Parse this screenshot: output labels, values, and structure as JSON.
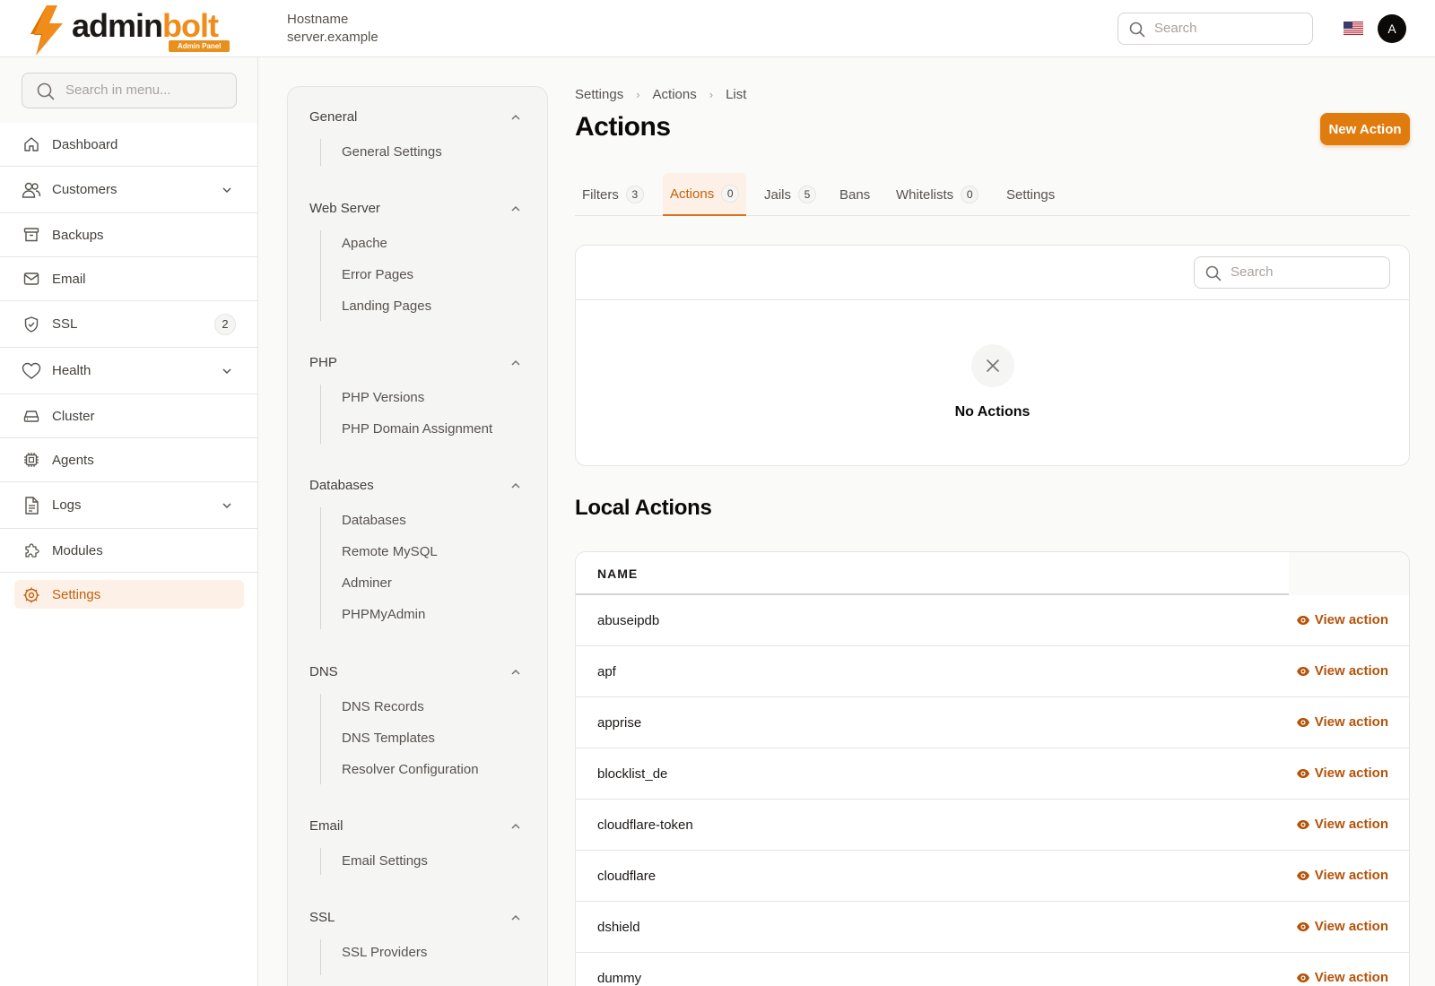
{
  "brand": {
    "name_part1": "admin",
    "name_part2": "bolt",
    "badge": "Admin Panel"
  },
  "header": {
    "hostname_label": "Hostname",
    "hostname_value": "server.example",
    "search_placeholder": "Search",
    "avatar_initial": "A"
  },
  "sidebar": {
    "search_placeholder": "Search in menu...",
    "items": [
      {
        "label": "Dashboard",
        "icon": "home-icon"
      },
      {
        "label": "Customers",
        "icon": "users-icon",
        "expandable": true
      },
      {
        "label": "Backups",
        "icon": "archive-icon"
      },
      {
        "label": "Email",
        "icon": "mail-icon"
      },
      {
        "label": "SSL",
        "icon": "shield-icon",
        "badge": "2"
      },
      {
        "label": "Health",
        "icon": "heart-icon",
        "expandable": true
      },
      {
        "label": "Cluster",
        "icon": "server-icon"
      },
      {
        "label": "Agents",
        "icon": "cpu-icon"
      },
      {
        "label": "Logs",
        "icon": "file-icon",
        "expandable": true
      },
      {
        "label": "Modules",
        "icon": "puzzle-icon"
      },
      {
        "label": "Settings",
        "icon": "cog-icon",
        "active": true
      }
    ]
  },
  "settings_menu": {
    "groups": [
      {
        "title": "General",
        "links": [
          "General Settings"
        ]
      },
      {
        "title": "Web Server",
        "links": [
          "Apache",
          "Error Pages",
          "Landing Pages"
        ]
      },
      {
        "title": "PHP",
        "links": [
          "PHP Versions",
          "PHP Domain Assignment"
        ]
      },
      {
        "title": "Databases",
        "links": [
          "Databases",
          "Remote MySQL",
          "Adminer",
          "PHPMyAdmin"
        ]
      },
      {
        "title": "DNS",
        "links": [
          "DNS Records",
          "DNS Templates",
          "Resolver Configuration"
        ]
      },
      {
        "title": "Email",
        "links": [
          "Email Settings"
        ]
      },
      {
        "title": "SSL",
        "links": [
          "SSL Providers"
        ]
      }
    ]
  },
  "breadcrumb": [
    "Settings",
    "Actions",
    "List"
  ],
  "page": {
    "title": "Actions",
    "new_button": "New Action"
  },
  "tabs": [
    {
      "label": "Filters",
      "count": "3"
    },
    {
      "label": "Actions",
      "count": "0",
      "active": true
    },
    {
      "label": "Jails",
      "count": "5"
    },
    {
      "label": "Bans"
    },
    {
      "label": "Whitelists",
      "count": "0"
    },
    {
      "label": "Settings"
    }
  ],
  "actions_card": {
    "search_placeholder": "Search",
    "empty_text": "No Actions"
  },
  "local_actions": {
    "title": "Local Actions",
    "column_name": "NAME",
    "view_label": "View action",
    "rows": [
      "abuseipdb",
      "apf",
      "apprise",
      "blocklist_de",
      "cloudflare-token",
      "cloudflare",
      "dshield",
      "dummy"
    ]
  },
  "colors": {
    "accent": "#e07b0d",
    "accent_text": "#c2610c",
    "link": "#b45309",
    "active_bg": "#fdf0e6"
  }
}
